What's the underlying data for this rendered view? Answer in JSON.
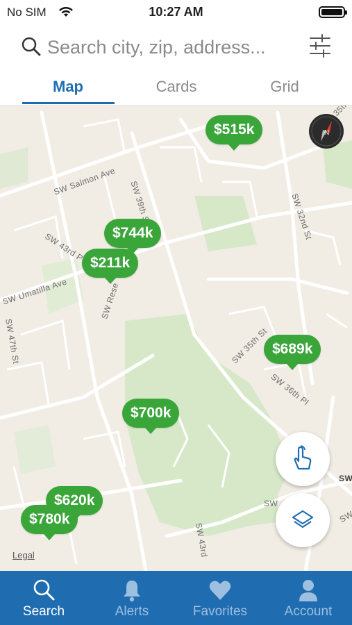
{
  "status_bar": {
    "carrier": "No SIM",
    "time": "10:27 AM"
  },
  "search": {
    "placeholder": "Search city, zip, address..."
  },
  "tabs": [
    {
      "label": "Map",
      "active": true
    },
    {
      "label": "Cards",
      "active": false
    },
    {
      "label": "Grid",
      "active": false
    }
  ],
  "map": {
    "street_labels": [
      "SW Salmon Ave",
      "SW 39th St",
      "SW 43rd P",
      "SW Umatilla Ave",
      "SW Rese",
      "SW 47th St",
      "SW 32nd St",
      "SW 35th St",
      "SW 36th Pl",
      "SW 43rd",
      "SW",
      "SW",
      "SW",
      "35th"
    ],
    "price_pins": [
      "$515k",
      "$744k",
      "$211k",
      "$689k",
      "$700k",
      "$620k",
      "$780k"
    ],
    "legal": "Legal",
    "pin_color": "#3aa63a"
  },
  "bottom_nav": [
    {
      "label": "Search",
      "icon": "search-icon",
      "active": true
    },
    {
      "label": "Alerts",
      "icon": "bell-icon",
      "active": false
    },
    {
      "label": "Favorites",
      "icon": "heart-icon",
      "active": false
    },
    {
      "label": "Account",
      "icon": "person-icon",
      "active": false
    }
  ],
  "colors": {
    "brand_blue": "#1f6db0",
    "map_background": "#f1ede5",
    "park_green": "#d7e8c9"
  }
}
